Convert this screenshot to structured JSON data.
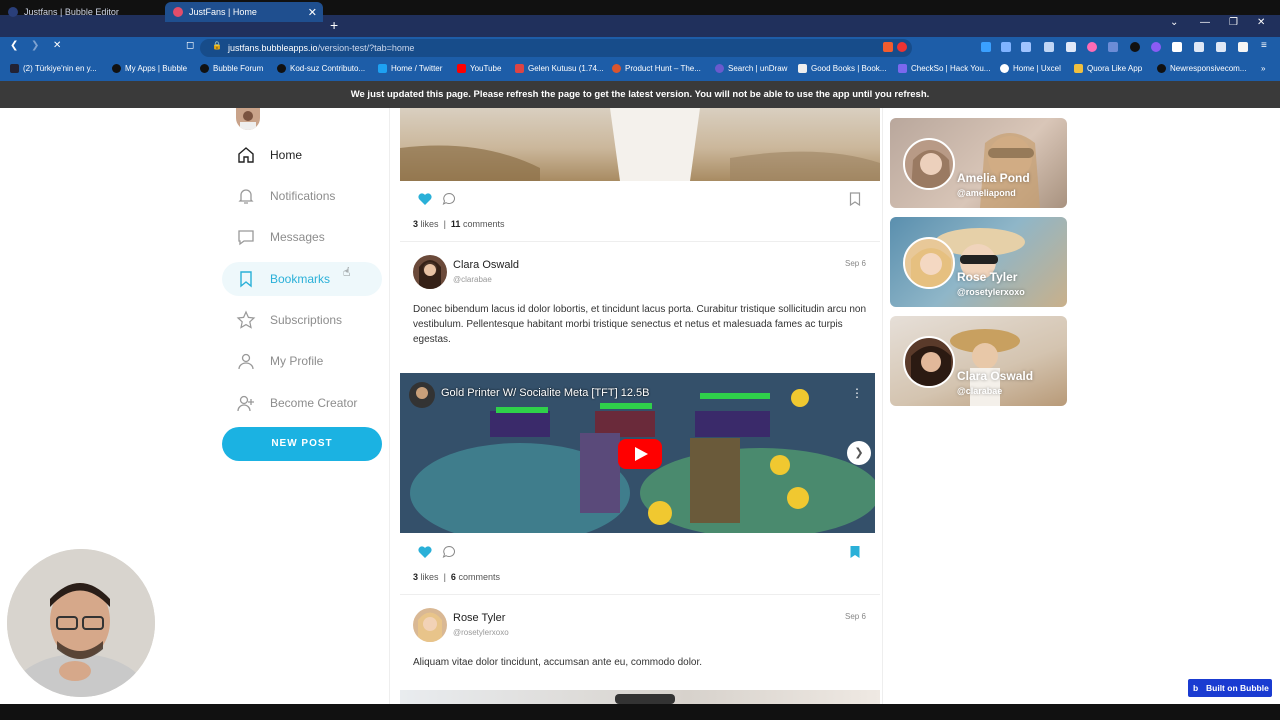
{
  "browser": {
    "tabs": [
      {
        "label": "Justfans | Bubble Editor",
        "active": false
      },
      {
        "label": "JustFans | Home",
        "active": true
      }
    ],
    "url_host": "justfans.bubbleapps.io",
    "url_path": "/version-test/?tab=home",
    "bookmarks": [
      "(2) Türkiye'nin en y...",
      "My Apps | Bubble",
      "Bubble Forum",
      "Kod-suz Contributo...",
      "Home / Twitter",
      "YouTube",
      "Gelen Kutusu (1.74...",
      "Product Hunt – The...",
      "Search | unDraw",
      "Good Books | Book...",
      "CheckSo | Hack You...",
      "Home | Uxcel",
      "Quora Like App",
      "Newresponsivecom..."
    ]
  },
  "notice": "We just updated this page. Please refresh the page to get the latest version. You will not be able to use the app until you refresh.",
  "sidebar": {
    "items": [
      {
        "label": "Home",
        "icon": "home-icon"
      },
      {
        "label": "Notifications",
        "icon": "bell-icon"
      },
      {
        "label": "Messages",
        "icon": "message-icon"
      },
      {
        "label": "Bookmarks",
        "icon": "bookmark-icon"
      },
      {
        "label": "Subscriptions",
        "icon": "star-icon"
      },
      {
        "label": "My Profile",
        "icon": "user-icon"
      },
      {
        "label": "Become Creator",
        "icon": "user-plus-icon"
      }
    ],
    "new_post": "NEW POST"
  },
  "feed": {
    "post0": {
      "likes": "3",
      "likes_label": "likes",
      "separator": "|",
      "comments": "11",
      "comments_label": "comments"
    },
    "post1": {
      "name": "Clara Oswald",
      "handle": "@clarabae",
      "date": "Sep 6",
      "text": "Donec bibendum lacus id dolor lobortis, et tincidunt lacus porta. Curabitur tristique sollicitudin arcu non vestibulum. Pellentesque habitant morbi tristique senectus et netus et malesuada fames ac turpis egestas.",
      "video_title": "Gold Printer W/ Socialite Meta [TFT] 12.5B",
      "likes": "3",
      "likes_label": "likes",
      "separator": "|",
      "comments": "6",
      "comments_label": "comments"
    },
    "post2": {
      "name": "Rose Tyler",
      "handle": "@rosetylerxoxo",
      "date": "Sep 6",
      "text": "Aliquam vitae dolor tincidunt, accumsan ante eu, commodo dolor."
    }
  },
  "creators": [
    {
      "name": "Amelia Pond",
      "handle": "@ameliapond"
    },
    {
      "name": "Rose Tyler",
      "handle": "@rosetylerxoxo"
    },
    {
      "name": "Clara Oswald",
      "handle": "@clarabae"
    }
  ],
  "badge": "Built on Bubble",
  "colors": {
    "accent": "#1bb2e2",
    "liked": "#2ab0d8"
  }
}
